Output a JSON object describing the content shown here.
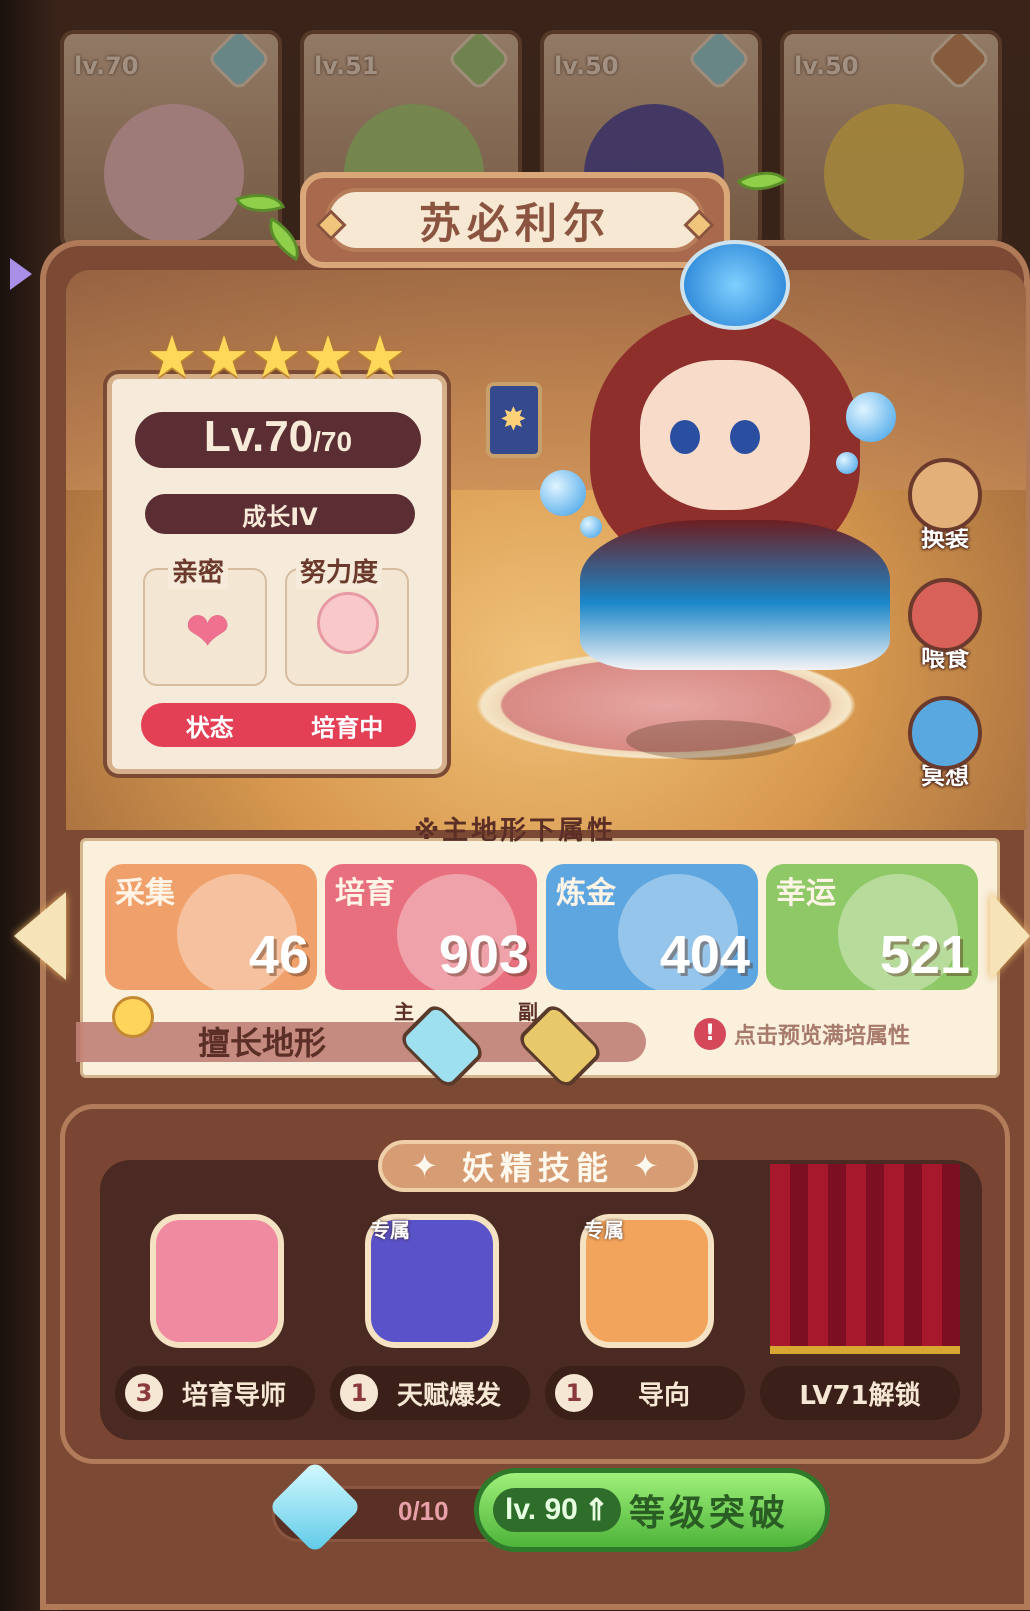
{
  "fairy_strip": [
    {
      "level": "lv.70",
      "element_color": "#8fd6e0"
    },
    {
      "level": "lv.51",
      "element_color": "#9ed27a"
    },
    {
      "level": "lv.50",
      "element_color": "#8fd6e0"
    },
    {
      "level": "lv.50",
      "element_color": "#c68a5a"
    }
  ],
  "character": {
    "name": "苏必利尔",
    "stars": [
      "★",
      "★",
      "★",
      "★",
      "★"
    ],
    "level_current": "Lv.70",
    "level_max": "/70",
    "growth": "成长IV",
    "intimacy_label": "亲密",
    "effort_label": "努力度",
    "status_label": "状态",
    "status_value": "培育中"
  },
  "side_actions": [
    {
      "label": "换装",
      "icon": "dress-icon"
    },
    {
      "label": "喂食",
      "icon": "meat-icon"
    },
    {
      "label": "冥想",
      "icon": "meditate-icon"
    }
  ],
  "attributes": {
    "header": "※主地形下属性",
    "items": [
      {
        "name": "采集",
        "value": "46",
        "color": "#f0a06a"
      },
      {
        "name": "培育",
        "value": "903",
        "color": "#e8707e"
      },
      {
        "name": "炼金",
        "value": "404",
        "color": "#5ea6e0"
      },
      {
        "name": "幸运",
        "value": "521",
        "color": "#8fc866"
      }
    ],
    "terrain_label": "擅长地形",
    "main_tag": "主",
    "sub_tag": "副",
    "main_terrain_color": "#9fe0f0",
    "sub_terrain_color": "#e8c96a",
    "preview_hint": "点击预览满培属性"
  },
  "skills": {
    "title": "妖精技能",
    "title_deco": "✦",
    "exclusive_tag": "专属",
    "items": [
      {
        "badge": "3",
        "name": "培育导师",
        "exclusive": false,
        "color": "#f08aa0",
        "icon": "tomato-icon"
      },
      {
        "badge": "1",
        "name": "天赋爆发",
        "exclusive": true,
        "color": "#5a52c8",
        "icon": "burst-icon"
      },
      {
        "badge": "1",
        "name": "导向",
        "exclusive": true,
        "color": "#f2a45c",
        "icon": "alarm-clock-icon"
      }
    ],
    "locked_label": "LV71解锁"
  },
  "breakthrough": {
    "crystal_count": "0/10",
    "level_tag": "lv. 90",
    "button_label": "等级突破"
  }
}
